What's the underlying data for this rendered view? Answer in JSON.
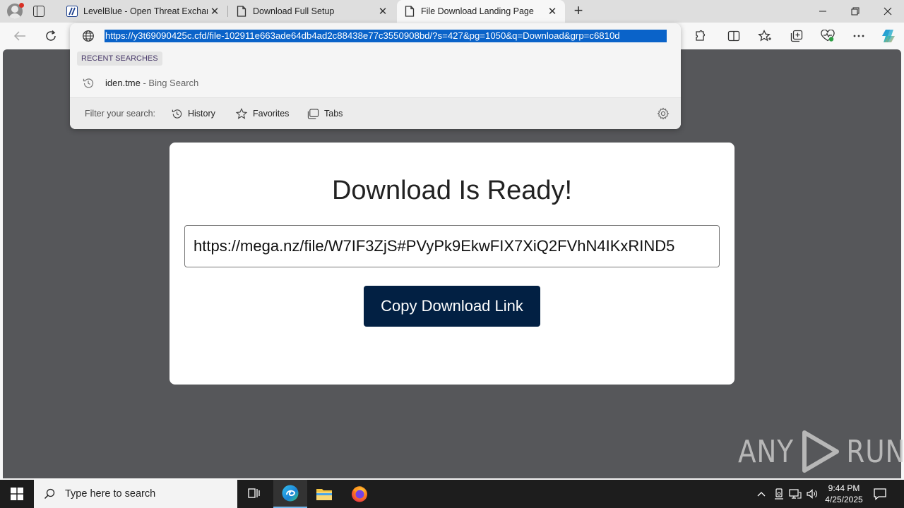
{
  "browser": {
    "tabs": [
      {
        "title": "LevelBlue - Open Threat Exchang",
        "active": false
      },
      {
        "title": "Download Full Setup",
        "active": false
      },
      {
        "title": "File Download Landing Page",
        "active": true
      }
    ],
    "url": "https://y3t69090425c.cfd/file-102911e663ade64db4ad2c88438e77c3550908bd/?s=427&pg=1050&q=Download&grp=c6810d"
  },
  "omnibox": {
    "recent_label": "RECENT SEARCHES",
    "suggestion_query": "iden.tme",
    "suggestion_source": " - Bing Search",
    "filter_label": "Filter your search:",
    "filters": [
      "History",
      "Favorites",
      "Tabs"
    ]
  },
  "page": {
    "title": "Download Is Ready!",
    "link": "https://mega.nz/file/W7IF3ZjS#PVyPk9EkwFIX7XiQ2FVhN4IKxRIND5",
    "copy_button": "Copy Download Link"
  },
  "watermark": {
    "left": "ANY",
    "right": "RUN"
  },
  "taskbar": {
    "search_placeholder": "Type here to search",
    "time": "9:44 PM",
    "date": "4/25/2025"
  },
  "colors": {
    "url_highlight": "#0a63c9",
    "copy_button_bg": "#022043",
    "page_bg": "#56575a",
    "taskbar_bg": "#1d1d1d"
  }
}
